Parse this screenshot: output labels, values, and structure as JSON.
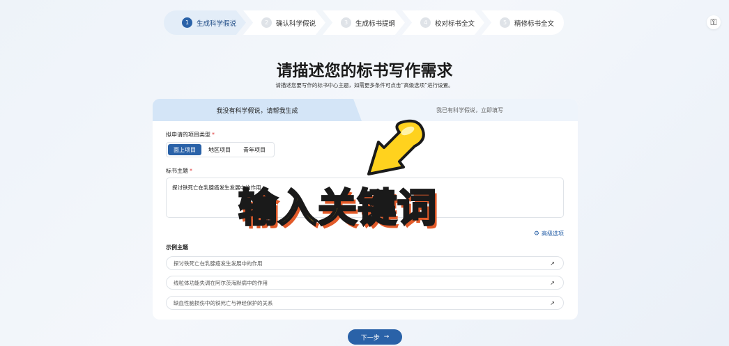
{
  "stepper": [
    {
      "num": "1",
      "label": "生成科学假说"
    },
    {
      "num": "2",
      "label": "确认科学假说"
    },
    {
      "num": "3",
      "label": "生成标书提纲"
    },
    {
      "num": "4",
      "label": "校对标书全文"
    },
    {
      "num": "5",
      "label": "精修标书全文"
    }
  ],
  "header": {
    "title": "请描述您的标书写作需求",
    "subtitle": "请描述您要写作的标书中心主题，如需更多条件可点击“高级选项”进行设置。"
  },
  "tabs": {
    "active": "我没有科学假说，请帮我生成",
    "inactive": "我已有科学假说，立即填写"
  },
  "form": {
    "project_type_label": "拟申请的项目类型",
    "required_mark": "*",
    "project_types": [
      "面上项目",
      "地区项目",
      "青年项目"
    ],
    "topic_label": "标书主题",
    "topic_value": "探讨铁死亡在乳腺癌发生发展中的作用",
    "advanced_label": "高级选项"
  },
  "examples": {
    "title": "示例主题",
    "items": [
      "探讨铁死亡在乳腺癌发生发展中的作用",
      "线粒体功能失调在阿尔茨海默病中的作用",
      "缺血性脑损伤中的铁死亡与神经保护的关系"
    ],
    "arrow": "↗"
  },
  "next_button": {
    "label": "下一步",
    "arrow": "→"
  },
  "overlay": {
    "caption": "输入关键词"
  },
  "colors": {
    "accent": "#2a62a8",
    "overlay_fill": "#ffd21e",
    "overlay_shadow": "#e25b2a"
  },
  "icons": {
    "key": "key-icon",
    "pointer": "arrow-pointer-icon",
    "advanced": "settings-icon"
  }
}
